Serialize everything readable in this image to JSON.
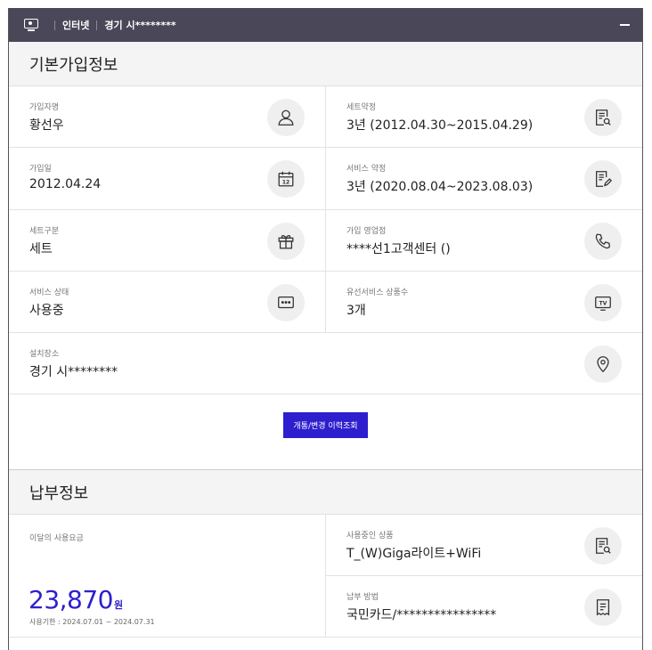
{
  "header": {
    "crumb_service": "인터넷",
    "crumb_address": "경기 시********"
  },
  "basic_info": {
    "title": "기본가입정보",
    "rows": [
      {
        "left": {
          "label": "가입자명",
          "value": "황선우",
          "icon": "person-icon"
        },
        "right": {
          "label": "세트약정",
          "value": "3년 (2012.04.30~2015.04.29)",
          "icon": "document-search-icon"
        }
      },
      {
        "left": {
          "label": "가입일",
          "value": "2012.04.24",
          "icon": "calendar-icon"
        },
        "right": {
          "label": "서비스 약정",
          "value": "3년 (2020.08.04~2023.08.03)",
          "icon": "document-edit-icon"
        }
      },
      {
        "left": {
          "label": "세트구분",
          "value": "세트",
          "icon": "gift-icon"
        },
        "right": {
          "label": "가입 영업점",
          "value": "****선1고객센터 ()",
          "icon": "phone-icon"
        }
      },
      {
        "left": {
          "label": "서비스 상태",
          "value": "사용중",
          "icon": "message-icon"
        },
        "right": {
          "label": "유선서비스 상품수",
          "value": "3개",
          "icon": "tv-icon"
        }
      }
    ],
    "location": {
      "label": "설치장소",
      "value": "경기 시********",
      "icon": "location-pin-icon"
    },
    "history_button": "개통/변경 이력조회"
  },
  "payment_info": {
    "title": "납부정보",
    "monthly_fee": {
      "label": "이달의 사용요금",
      "amount": "23,870",
      "unit": "원",
      "period": "사용기한 : 2024.07.01 ~ 2024.07.31"
    },
    "product": {
      "label": "사용중인 상품",
      "value": "T_(W)Giga라이트+WiFi",
      "icon": "document-search-icon"
    },
    "method": {
      "label": "납부 방법",
      "value": "국민카드/****************",
      "icon": "receipt-icon"
    }
  },
  "colors": {
    "header_bg": "#4a4759",
    "accent": "#2d1fce",
    "section_bg": "#f4f4f4"
  }
}
